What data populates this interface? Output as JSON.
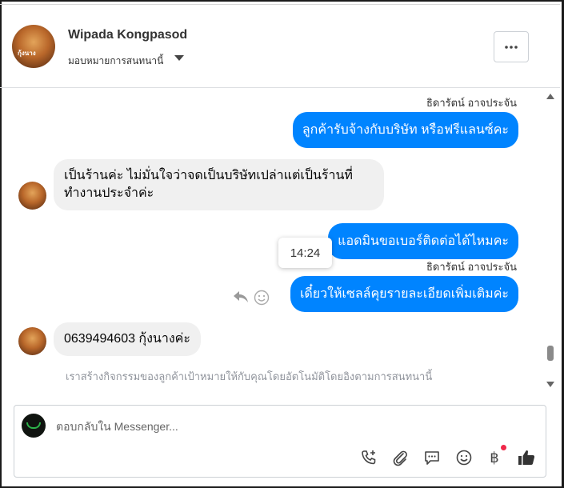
{
  "header": {
    "contact_name": "Wipada Kongpasod",
    "avatar_caption": "กุ้งนาง",
    "assign_label": "มอบหมายการสนทนานี้"
  },
  "thread": {
    "messages": [
      {
        "sender": "ธิดารัตน์ อาจประจัน",
        "text": "ลูกค้ารับจ้างกับบริษัท หรือฟรีแลนซ์คะ",
        "direction": "out"
      },
      {
        "text_line1": "เป็นร้านค่ะ ไม่มั่นใจว่าจดเป็นบริษัทเปล่าแต่เป็นร้านที่",
        "text_line2": "ทำงานประจำค่ะ",
        "direction": "in"
      },
      {
        "text": "แอดมินขอเบอร์ติดต่อได้ไหมคะ",
        "direction": "out"
      },
      {
        "sender": "ธิดารัตน์ อาจประจัน",
        "text": "เดี๋ยวให้เซลล์คุยรายละเอียดเพิ่มเติมค่ะ",
        "direction": "out"
      },
      {
        "text": "0639494603 กุ้งนางค่ะ",
        "direction": "in"
      }
    ],
    "timestamp_tooltip": "14:24",
    "notice": "เราสร้างกิจกรรมของลูกค้าเป้าหมายให้กับคุณโดยอัตโนมัติโดยอิงตามการสนทนานี้"
  },
  "composer": {
    "placeholder": "ตอบกลับใน Messenger...",
    "tools": [
      "call-plus-icon",
      "attachment-icon",
      "saved-reply-icon",
      "emoji-icon",
      "baht-payment-icon",
      "like-icon"
    ],
    "baht_symbol": "฿"
  },
  "colors": {
    "outgoing_bubble": "#0084ff",
    "incoming_bubble": "#f0f0f0",
    "notification_dot": "#f02849"
  }
}
